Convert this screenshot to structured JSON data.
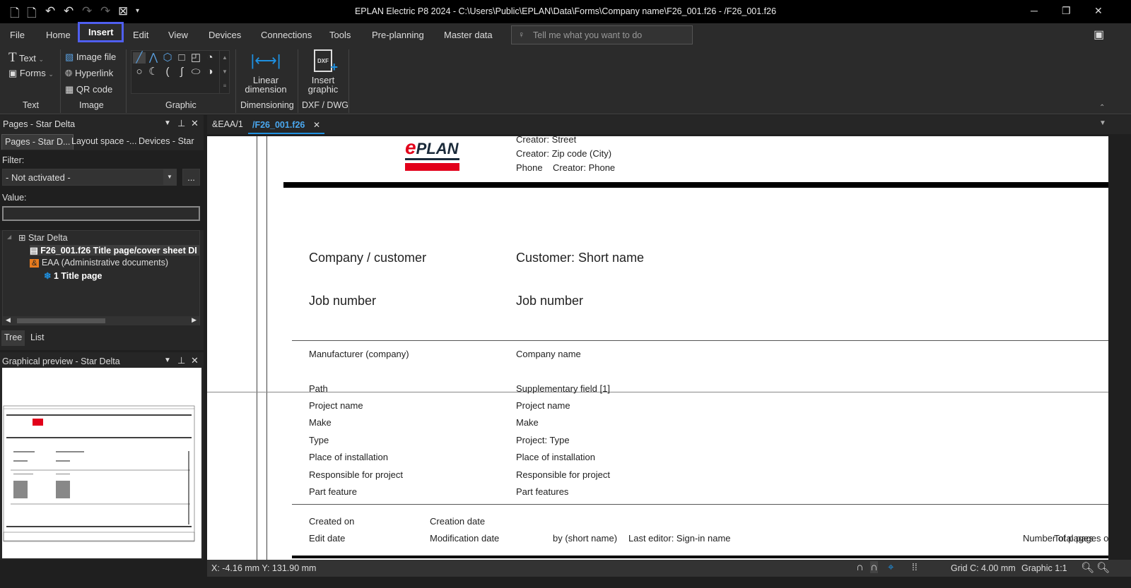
{
  "titlebar": {
    "title": "EPLAN Electric P8 2024 - C:\\Users\\Public\\EPLAN\\Data\\Forms\\Company name\\F26_001.f26 - /F26_001.f26",
    "minimize": "─",
    "restore": "❐",
    "close": "✕"
  },
  "menu": {
    "tabs": [
      "File",
      "Home",
      "Insert",
      "Edit",
      "View",
      "Devices",
      "Connections",
      "Tools",
      "Pre-planning",
      "Master data"
    ],
    "search_placeholder": "Tell me what you want to do"
  },
  "ribbon": {
    "text_group": {
      "label": "Text",
      "items": [
        "Text",
        "Forms"
      ]
    },
    "image_group": {
      "label": "Image",
      "items": [
        "Image file",
        "Hyperlink",
        "QR code"
      ]
    },
    "graphic_group": {
      "label": "Graphic"
    },
    "dimensioning_group": {
      "label": "Dimensioning",
      "button_line1": "Linear",
      "button_line2": "dimension"
    },
    "dxf_group": {
      "label": "DXF / DWG",
      "button_line1": "Insert",
      "button_line2": "graphic",
      "icon_text": "DXF"
    }
  },
  "pages_panel": {
    "title": "Pages - Star Delta",
    "tabs": [
      "Pages - Star D...",
      "Layout space -...",
      "Devices - Star ..."
    ],
    "filter_label": "Filter:",
    "filter_value": "- Not activated -",
    "more_btn": "...",
    "value_label": "Value:",
    "value": "",
    "tree": [
      {
        "label": "Star Delta"
      },
      {
        "label": "F26_001.f26 Title page/cover sheet DI"
      },
      {
        "label": "EAA (Administrative documents)",
        "icon_text": "&"
      },
      {
        "label": "1 Title page"
      }
    ],
    "bottom_tabs": [
      "Tree",
      "List"
    ]
  },
  "preview_panel": {
    "title": "Graphical preview - Star Delta"
  },
  "doc_tabs": [
    {
      "label": "&EAA/1",
      "active": false
    },
    {
      "label": "/F26_001.f26",
      "active": true
    }
  ],
  "document": {
    "logo": "ePLAN",
    "header_lines": [
      "Creator: Street",
      "Creator: Zip code (City)",
      "Phone",
      "Creator: Phone"
    ],
    "big_rows": [
      [
        "Company / customer",
        "Customer: Short name"
      ],
      [
        "Job number",
        "Job number"
      ]
    ],
    "manufacturer": [
      "Manufacturer (company)",
      "Company name"
    ],
    "path": [
      "Path",
      "Supplementary field [1]"
    ],
    "rows": [
      [
        "Project name",
        "Project name"
      ],
      [
        "Make",
        "Make"
      ],
      [
        "Type",
        "Project: Type"
      ],
      [
        "Place of installation",
        "Place of installation"
      ],
      [
        "Responsible for project",
        "Responsible for project"
      ],
      [
        "Part feature",
        "Part features"
      ]
    ],
    "footer": {
      "created_on": "Created on",
      "creation_date": "Creation date",
      "edit_date": "Edit date",
      "modification_date": "Modification date",
      "by": "by (short name)",
      "last_editor": "Last editor: Sign-in name",
      "pages": "Number of pages",
      "total": "Total pages of p"
    }
  },
  "status": {
    "coords": "X: -4.16 mm Y: 131.90 mm",
    "grid": "Grid C: 4.00 mm",
    "graphic": "Graphic 1:1"
  },
  "colors": {
    "accent": "#4f5ff0",
    "blue": "#1e90e0",
    "eplan_red": "#e2001a"
  }
}
